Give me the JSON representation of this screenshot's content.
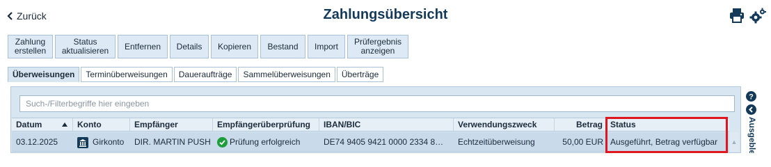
{
  "header": {
    "back_label": "Zurück",
    "title": "Zahlungsübersicht"
  },
  "toolbar": [
    {
      "label": "Zahlung\nerstellen"
    },
    {
      "label": "Status\naktualisieren"
    },
    {
      "label": "Entfernen"
    },
    {
      "label": "Details"
    },
    {
      "label": "Kopieren"
    },
    {
      "label": "Bestand"
    },
    {
      "label": "Import"
    },
    {
      "label": "Prüfergebnis\nanzeigen"
    }
  ],
  "tabs": [
    {
      "label": "Überweisungen",
      "active": true
    },
    {
      "label": "Terminüberweisungen"
    },
    {
      "label": "Daueraufträge"
    },
    {
      "label": "Sammelüberweisungen"
    },
    {
      "label": "Überträge"
    }
  ],
  "search": {
    "placeholder": "Such-/Filterbegriffe hier eingeben"
  },
  "table": {
    "columns": [
      "Datum",
      "Konto",
      "Empfänger",
      "Empfängerüberprüfung",
      "IBAN/BIC",
      "Verwendungszweck",
      "Betrag",
      "Status"
    ],
    "sort_column": "Datum",
    "rows": [
      {
        "datum": "03.12.2025",
        "konto": "Girkonto",
        "empfaenger": "DIR. MARTIN PUSH",
        "pruefung": "Prüfung erfolgreich",
        "iban": "DE74 9405 9421 0000 2334 8…",
        "zweck": "Echtzeitüberweisung",
        "betrag": "50,00 EUR",
        "status": "Ausgeführt, Betrag verfügbar"
      }
    ]
  },
  "side_panel": {
    "label": "Ausgeblendet"
  },
  "colors": {
    "accent": "#143a5a",
    "highlight": "#e0161e",
    "success": "#1e9e3a"
  }
}
